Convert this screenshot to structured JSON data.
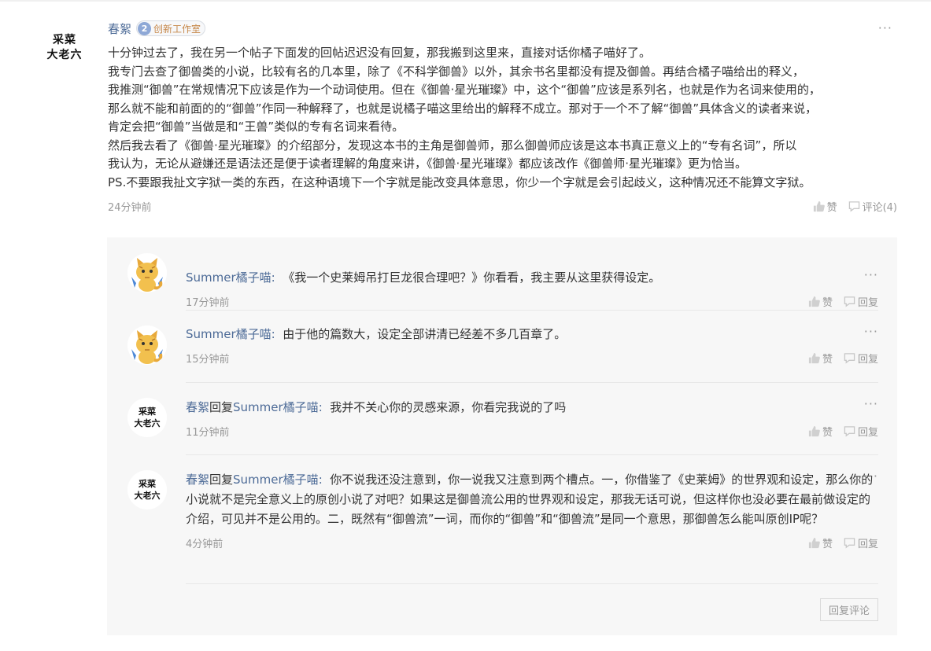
{
  "post": {
    "author": "春絮",
    "level_number": "2",
    "level_title": "创新工作室",
    "avatar_line1": "采菜",
    "avatar_line2": "大老六",
    "more": "···",
    "paragraphs": [
      "十分钟过去了，我在另一个帖子下面发的回帖迟迟没有回复，那我搬到这里来，直接对话你橘子喵好了。",
      "我专门去查了御兽类的小说，比较有名的几本里，除了《不科学御兽》以外，其余书名里都没有提及御兽。再结合橘子喵给出的释义，",
      "我推测“御兽”在常规情况下应该是作为一个动词使用。但在《御兽·星光璀璨》中，这个“御兽”应该是系列名，也就是作为名词来使用的，",
      "那么就不能和前面的的“御兽”作同一种解释了，也就是说橘子喵这里给出的解释不成立。那对于一个不了解“御兽”具体含义的读者来说，",
      "肯定会把“御兽”当做是和“王兽”类似的专有名词来看待。",
      "然后我去看了《御兽·星光璀璨》的介绍部分，发现这本书的主角是御兽师，那么御兽师应该是这本书真正意义上的“专有名词”，所以",
      "我认为，无论从避嫌还是语法还是便于读者理解的角度来讲，《御兽·星光璀璨》都应该改作《御兽师·星光璀璨》更为恰当。",
      "PS.不要跟我扯文字狱一类的东西，在这种语境下一个字就是能改变具体意思，你少一个字就是会引起歧义，这种情况还不能算文字狱。"
    ],
    "time": "24分钟前",
    "like_label": "赞",
    "comment_label": "评论(4)"
  },
  "replies": [
    {
      "author": "Summer橘子喵",
      "reply_word": "",
      "target": "",
      "colon": ":",
      "text": "《我一个史莱姆吊打巨龙很合理吧？》你看看，我主要从这里获得设定。",
      "time": "17分钟前",
      "like_label": "赞",
      "reply_label": "回复",
      "more": "···"
    },
    {
      "author": "Summer橘子喵",
      "reply_word": "",
      "target": "",
      "colon": ":",
      "text": "由于他的篇数大，设定全部讲清已经差不多几百章了。",
      "time": "15分钟前",
      "like_label": "赞",
      "reply_label": "回复",
      "more": "···"
    },
    {
      "author": "春絮",
      "reply_word": "回复",
      "target": "Summer橘子喵",
      "colon": ":",
      "text": "我并不关心你的灵感来源，你看完我说的了吗",
      "time": "11分钟前",
      "like_label": "赞",
      "reply_label": "回复",
      "more": "···",
      "avatar_line1": "采菜",
      "avatar_line2": "大老六"
    },
    {
      "author": "春絮",
      "reply_word": "回复",
      "target": "Summer橘子喵",
      "colon": ":",
      "text": "你不说我还没注意到，你一说我又注意到两个槽点。一，你借鉴了《史莱姆》的世界观和设定，那么你的小说就不是完全意义上的原创小说了对吧？如果这是御兽流公用的世界观和设定，那我无话可说，但这样你也没必要在最前做设定的介绍，可见并不是公用的。二，既然有“御兽流”一词，而你的“御兽”和“御兽流”是同一个意思，那御兽怎么能叫原创IP呢？",
      "time": "4分钟前",
      "like_label": "赞",
      "reply_label": "回复",
      "more": "···",
      "avatar_line1": "采菜",
      "avatar_line2": "大老六"
    }
  ],
  "reply_comment_button": "回复评论",
  "colors": {
    "link": "#4d6b97",
    "meta": "#999999",
    "panel": "#f7f7f7"
  }
}
